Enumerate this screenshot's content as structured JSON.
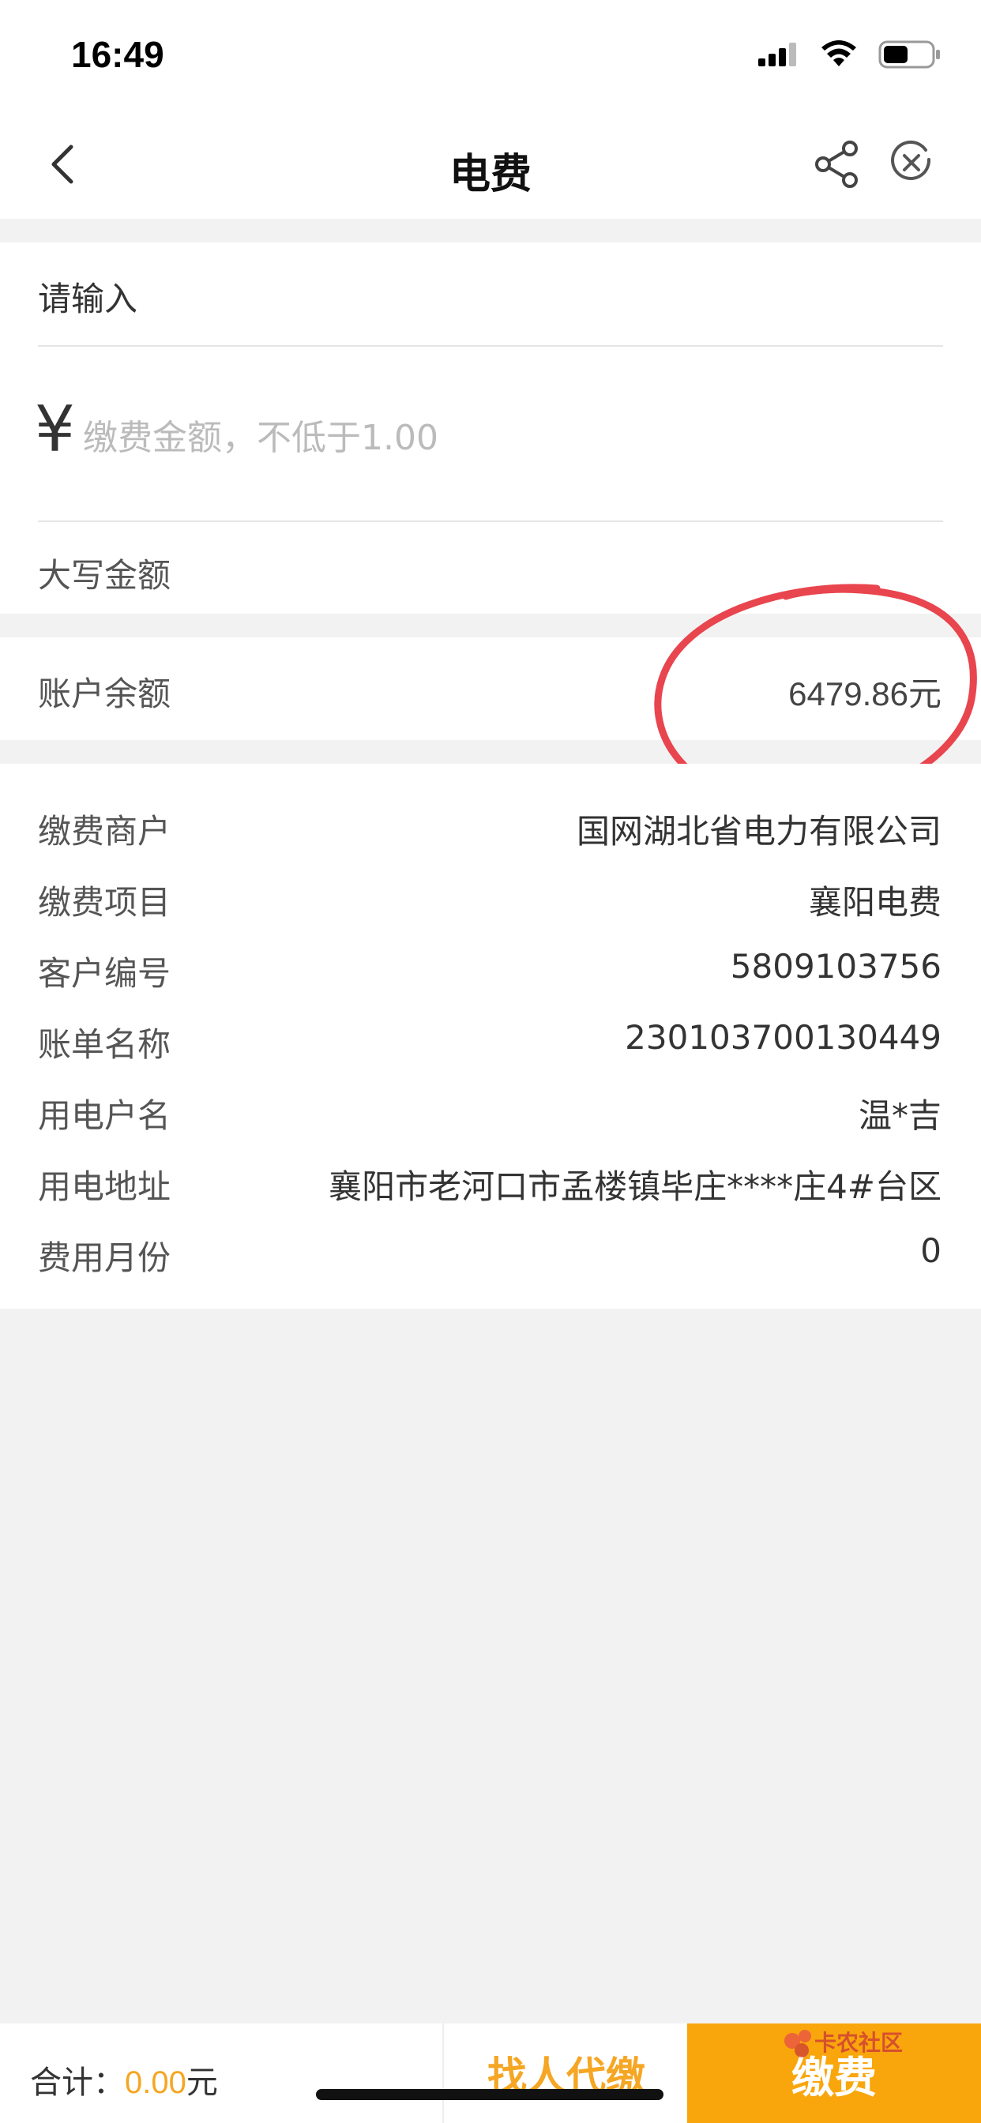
{
  "status": {
    "time": "16:49"
  },
  "nav": {
    "title": "电费"
  },
  "form": {
    "prompt": "请输入",
    "currency_symbol": "¥",
    "amount_placeholder": "缴费金额，不低于1.00",
    "uppercase_label": "大写金额"
  },
  "balance": {
    "label": "账户余额",
    "value": "6479.86元"
  },
  "details": [
    {
      "label": "缴费商户",
      "value": "国网湖北省电力有限公司"
    },
    {
      "label": "缴费项目",
      "value": "襄阳电费"
    },
    {
      "label": "客户编号",
      "value": "5809103756"
    },
    {
      "label": "账单名称",
      "value": "230103700130449"
    },
    {
      "label": "用电户名",
      "value": "温*吉"
    },
    {
      "label": "用电地址",
      "value": "襄阳市老河口市孟楼镇毕庄****庄4#台区"
    },
    {
      "label": "费用月份",
      "value": "0"
    }
  ],
  "footer": {
    "total_label": "合计：",
    "total_amount": "0.00",
    "total_unit": "元",
    "proxy_label": "找人代缴",
    "pay_label": "缴费"
  },
  "watermark": {
    "text": "卡农社区"
  },
  "colors": {
    "accent": "#f9a60c",
    "annotation": "#e8454e"
  },
  "icons": [
    "signal-icon",
    "wifi-icon",
    "battery-icon",
    "back-arrow-icon",
    "share-icon",
    "close-icon"
  ]
}
